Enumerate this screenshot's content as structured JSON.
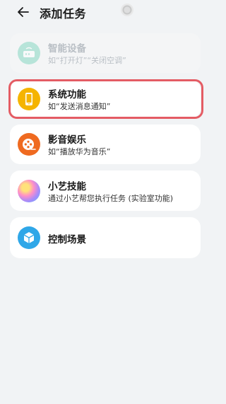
{
  "header": {
    "title": "添加任务",
    "back_icon": "back-arrow-icon"
  },
  "items": [
    {
      "name": "智能设备",
      "subtitle": "如“打开灯”“关闭空调”",
      "icon": "router-icon",
      "color": "#6fd0b6",
      "disabled": true
    },
    {
      "name": "系统功能",
      "subtitle": "如“发送消息通知”",
      "icon": "phone-icon",
      "color": "#f5b400",
      "disabled": false,
      "highlighted": true
    },
    {
      "name": "影音娱乐",
      "subtitle": "如“播放华为音乐”",
      "icon": "film-reel-icon",
      "color": "#ef6a20",
      "disabled": false
    },
    {
      "name": "小艺技能",
      "subtitle": "通过小艺帮您执行任务 (实验室功能)",
      "icon": "xiaoyi-orb-icon",
      "color": "#a78bfa",
      "disabled": false
    },
    {
      "name": "控制场景",
      "subtitle": "",
      "icon": "cube-icon",
      "color": "#2fa7e8",
      "disabled": false
    }
  ]
}
